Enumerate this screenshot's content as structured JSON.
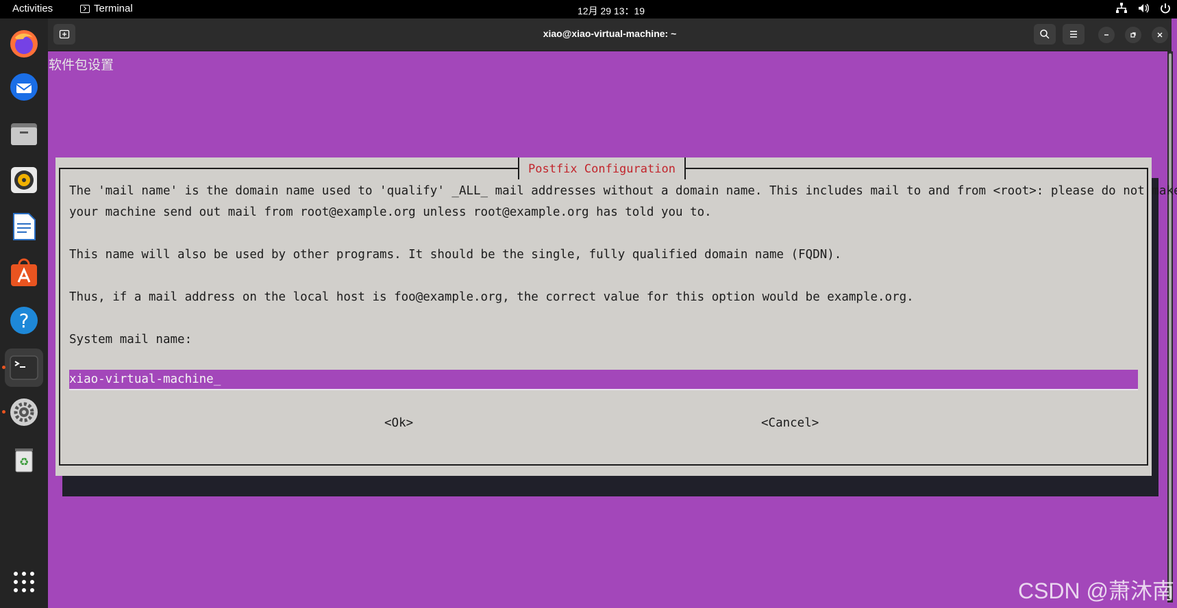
{
  "topbar": {
    "activities": "Activities",
    "app_name": "Terminal",
    "clock": "12月 29  13：19"
  },
  "dock": {
    "items": [
      "firefox-icon",
      "thunderbird-icon",
      "files-icon",
      "rhythmbox-icon",
      "libreoffice-writer-icon",
      "app-center-icon",
      "help-icon",
      "terminal-icon",
      "settings-icon",
      "trash-icon",
      "show-apps-icon"
    ]
  },
  "terminal": {
    "title": "xiao@xiao-virtual-machine: ~",
    "package_title": "软件包设置"
  },
  "dialog": {
    "title": "Postfix Configuration",
    "lines": [
      "The 'mail name' is the domain name used to 'qualify' _ALL_ mail addresses without a domain name. This includes mail to and from <root>: please do not make",
      "your machine send out mail from root@example.org unless root@example.org has told you to.",
      "This name will also be used by other programs. It should be the single, fully qualified domain name (FQDN).",
      "Thus, if a mail address on the local host is foo@example.org, the correct value for this option would be example.org.",
      "System mail name:"
    ],
    "input_value": "xiao-virtual-machine_",
    "ok_label": "<Ok>",
    "cancel_label": "<Cancel>"
  },
  "watermark": "CSDN @萧沐南",
  "colors": {
    "terminal_bg": "#a347ba",
    "dialog_bg": "#d1cfcb",
    "dialog_title": "#c2252c"
  }
}
